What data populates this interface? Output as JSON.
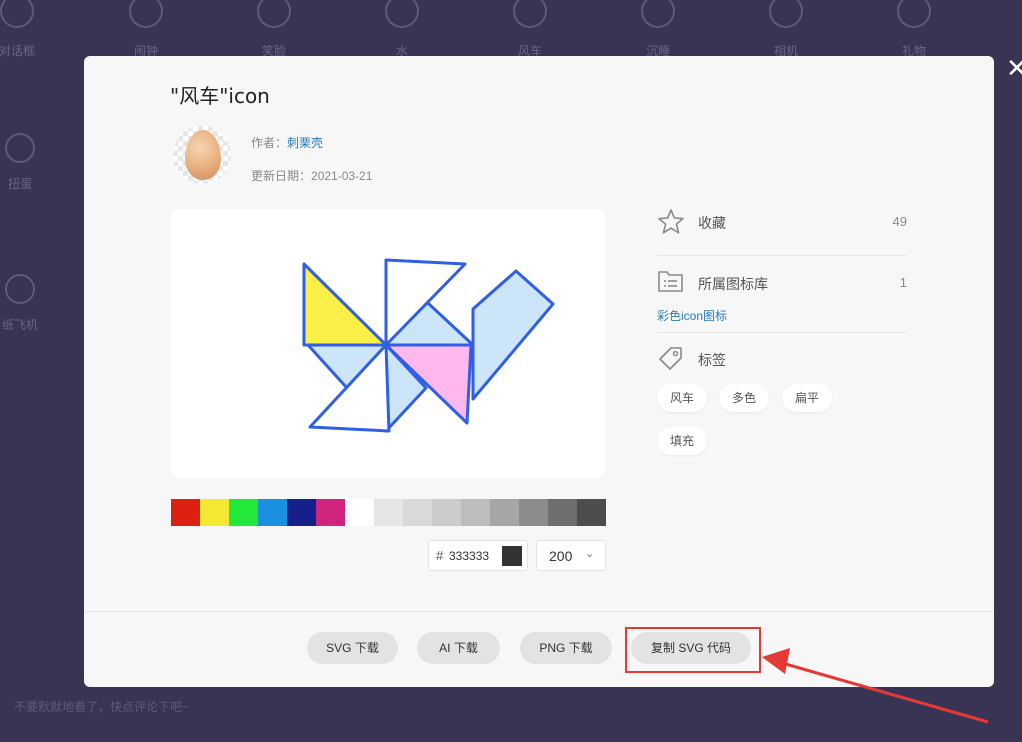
{
  "background": {
    "top_nav": [
      {
        "label": "对话框",
        "icon": "dialog-icon"
      },
      {
        "label": "闹钟",
        "icon": "alarm-clock-icon"
      },
      {
        "label": "笑脸",
        "icon": "smile-icon"
      },
      {
        "label": "水",
        "icon": "water-icon"
      },
      {
        "label": "风车",
        "icon": "pinwheel-icon"
      },
      {
        "label": "沉睡",
        "icon": "sleep-face-icon"
      },
      {
        "label": "相机",
        "icon": "camera-icon"
      },
      {
        "label": "礼物",
        "icon": "gift-icon"
      }
    ],
    "side_nav": [
      {
        "label": "扭蛋",
        "icon": "gashapon-icon"
      },
      {
        "label": "纸飞机",
        "icon": "paper-plane-icon"
      }
    ],
    "comment_placeholder": "不要默默地看了，快点评论下吧~"
  },
  "modal": {
    "title": "\"风车\"icon",
    "author_label": "作者：",
    "author_name": "刺栗壳",
    "date_label": "更新日期：",
    "date": "2021-03-21",
    "palette": [
      "#dd2010",
      "#f5e833",
      "#22e83a",
      "#1a90e0",
      "#15208a",
      "#d0257e",
      "#ffffff",
      "#e6e6e6",
      "#d9d9d9",
      "#cccccc",
      "#bdbdbd",
      "#a6a6a6",
      "#8c8c8c",
      "#6e6e6e",
      "#4d4d4d",
      "#2b2b2b"
    ],
    "color_hash": "#",
    "color_value": "333333",
    "size_value": "200",
    "favorite": {
      "label": "收藏",
      "count": "49"
    },
    "library": {
      "label": "所属图标库",
      "count": "1",
      "link": "彩色icon图标"
    },
    "tags_label": "标签",
    "tags": [
      "风车",
      "多色",
      "扁平",
      "填充"
    ],
    "buttons": {
      "svg_download": "SVG 下载",
      "ai_download": "AI 下载",
      "png_download": "PNG 下载",
      "copy_svg": "复制 SVG 代码"
    }
  },
  "colors": {
    "pinwheel_stroke": "#2f5fe6",
    "pinwheel_light_blue": "#cce5f9",
    "pinwheel_yellow": "#fbef4a",
    "pinwheel_pink": "#ffb8ec",
    "highlight_red": "#e53935",
    "link_blue": "#2a7ab8"
  }
}
